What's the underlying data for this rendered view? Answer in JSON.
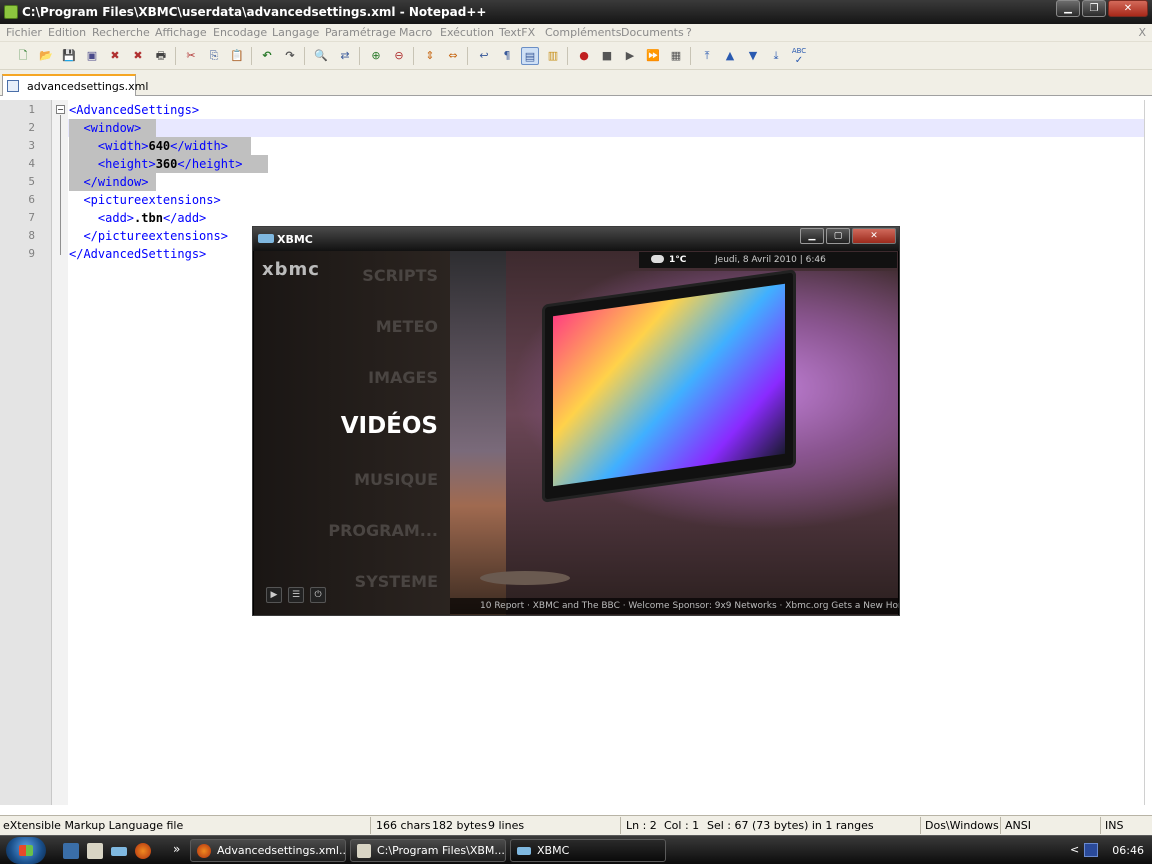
{
  "window": {
    "title": "C:\\Program Files\\XBMC\\userdata\\advancedsettings.xml - Notepad++",
    "minimize": "▁",
    "maximize": "❐",
    "close": "✕"
  },
  "menu": {
    "items": [
      "Fichier",
      "Edition",
      "Recherche",
      "Affichage",
      "Encodage",
      "Langage",
      "Paramétrage",
      "Macro",
      "Exécution",
      "TextFX",
      "Compléments",
      "Documents",
      "?"
    ],
    "close_x": "X"
  },
  "toolbar": {
    "icons": [
      "new-file-icon",
      "open-file-icon",
      "save-icon",
      "save-all-icon",
      "close-icon",
      "close-all-icon",
      "print-icon",
      "cut-icon",
      "copy-icon",
      "paste-icon",
      "undo-icon",
      "redo-icon",
      "find-icon",
      "replace-icon",
      "zoom-in-icon",
      "zoom-out-icon",
      "sync-vertical-icon",
      "sync-horizontal-icon",
      "word-wrap-icon",
      "show-all-chars-icon",
      "indent-guide-icon",
      "user-lang-icon",
      "record-macro-icon",
      "stop-record-icon",
      "playback-icon",
      "run-macro-multiple-icon",
      "save-macro-icon",
      "move-top-icon",
      "move-up-icon",
      "move-down-icon",
      "move-bottom-icon",
      "spell-check-icon"
    ],
    "glyphs": [
      "🗋",
      "📂",
      "💾",
      "▣",
      "✖",
      "✖",
      "🖶",
      "✂",
      "⎘",
      "📋",
      "↶",
      "↷",
      "🔍",
      "⇄",
      "⊕",
      "⊖",
      "⇕",
      "⇔",
      "↩",
      "¶",
      "▤",
      "▥",
      "●",
      "■",
      "▶",
      "⏩",
      "▦",
      "⤒",
      "▲",
      "▼",
      "⤓",
      "✓"
    ],
    "spell_label": "ABC"
  },
  "tabs": [
    {
      "label": "advancedsettings.xml"
    }
  ],
  "editor": {
    "lines": [
      {
        "num": "1",
        "indent": "",
        "open": "<AdvancedSettings>",
        "value": "",
        "close": ""
      },
      {
        "num": "2",
        "indent": "  ",
        "open": "<window>",
        "value": "",
        "close": ""
      },
      {
        "num": "3",
        "indent": "    ",
        "open": "<width>",
        "value": "640",
        "close": "</width>"
      },
      {
        "num": "4",
        "indent": "    ",
        "open": "<height>",
        "value": "360",
        "close": "</height>"
      },
      {
        "num": "5",
        "indent": "  ",
        "open": "</window>",
        "value": "",
        "close": ""
      },
      {
        "num": "6",
        "indent": "  ",
        "open": "<pictureextensions>",
        "value": "",
        "close": ""
      },
      {
        "num": "7",
        "indent": "    ",
        "open": "<add>",
        "value": ".tbn",
        "close": "</add>"
      },
      {
        "num": "8",
        "indent": "  ",
        "open": "</pictureextensions>",
        "value": "",
        "close": ""
      },
      {
        "num": "9",
        "indent": "",
        "open": "</AdvancedSettings>",
        "value": "",
        "close": ""
      }
    ]
  },
  "xbmc": {
    "title": "XBMC",
    "brand": "xbmc",
    "minimize": "▁",
    "maximize": "▢",
    "close": "✕",
    "menu_items": [
      "SCRIPTS",
      "METEO",
      "IMAGES",
      "VIDÉOS",
      "MUSIQUE",
      "PROGRAM...",
      "SYSTEME"
    ],
    "selected_item": "VIDÉOS",
    "weather_temp": "1°C",
    "date_time": "Jeudi, 8 Avril 2010 | 6:46",
    "ticker": "10 Report · XBMC and The BBC · Welcome Sponsor: 9x9 Networks · Xbmc.org Gets a New Home · Co",
    "controls": [
      "▶",
      "☰",
      "⏻"
    ]
  },
  "status": {
    "file_type": "eXtensible Markup Language file",
    "chars": "166 chars",
    "bytes": "182 bytes",
    "lines": "9 lines",
    "ln": "Ln : 2",
    "col": "Col : 1",
    "sel": "Sel : 67 (73 bytes) in 1 ranges",
    "eol": "Dos\\Windows",
    "encoding": "ANSI",
    "mode": "INS"
  },
  "taskbar": {
    "buttons": [
      {
        "label": "Advancedsettings.xml..."
      },
      {
        "label": "C:\\Program Files\\XBM..."
      },
      {
        "label": "XBMC"
      }
    ],
    "overflow": "»",
    "tray_arrow": "<",
    "clock": "06:46"
  },
  "colors": {
    "xml_tag": "#0000ff",
    "current_line": "#e8e8ff",
    "selection": "#c0c0c0",
    "tab_accent": "#f5a623"
  }
}
